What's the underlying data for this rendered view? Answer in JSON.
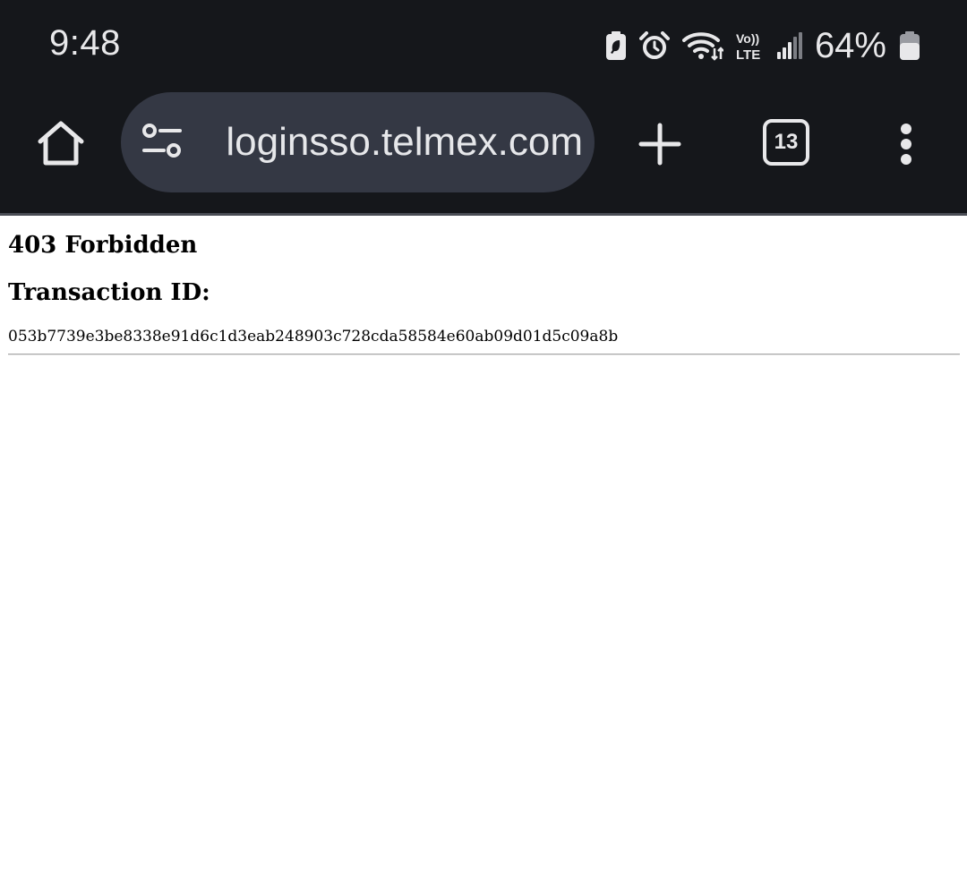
{
  "status_bar": {
    "time": "9:48",
    "battery_percent": "64%",
    "network_label": "Vo)) LTE",
    "icons": [
      "battery-saver-icon",
      "alarm-icon",
      "wifi-icon",
      "volte-lte-icon",
      "signal-icon",
      "battery-icon"
    ]
  },
  "browser": {
    "url": "loginsso.telmex.com",
    "tab_count": "13",
    "icons": [
      "home-icon",
      "page-info-tune-icon",
      "plus-icon",
      "tab-switcher-icon",
      "more-vert-icon"
    ]
  },
  "page": {
    "title": "403 Forbidden",
    "transaction_label": "Transaction ID:",
    "transaction_id": "053b7739e3be8338e91d6c1d3eab248903c728cda58584e60ab09d01d5c09a8b"
  },
  "colors": {
    "chrome_bg": "#15171b",
    "omnibox_bg": "#343844",
    "icon_fg": "#e8e8ea",
    "page_bg": "#ffffff"
  }
}
